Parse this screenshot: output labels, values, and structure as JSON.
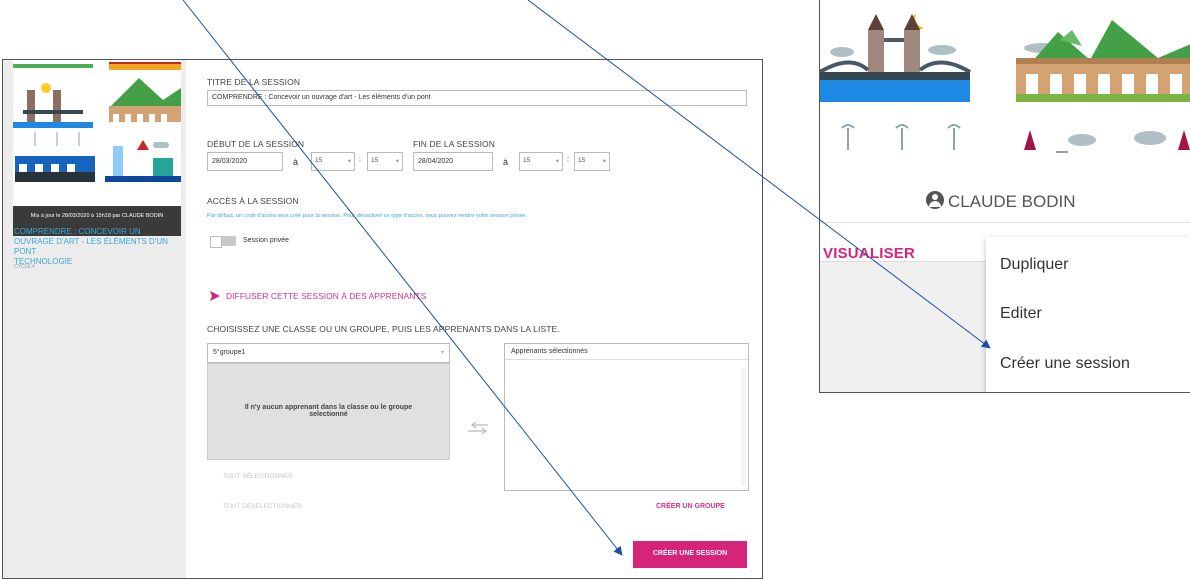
{
  "main": {
    "update_text": "Mis à jour le  28/03/2020 à 15h18  par CLAUDE BODIN",
    "course_title": "COMPRENDRE : CONCEVOIR UN OUVRAGE D'ART - LES ÉLÉMENTS D'UN PONT",
    "subject": "TECHNOLOGIE",
    "cycle": "CYCLE 4",
    "title_label": "TITRE DE LA SESSION",
    "title_value": "COMPRENDRE : Concevoir un ouvrage d'art - Les éléments d'un pont",
    "start_label": "DÉBUT DE LA SESSION",
    "start_date": "28/03/2020",
    "start_hour": "15",
    "start_min": "15",
    "end_label": "FIN DE LA SESSION",
    "end_date": "28/04/2020",
    "end_hour": "15",
    "end_min": "15",
    "at_label": "à",
    "colon": ":",
    "access_label": "ACCÈS À LA SESSION",
    "access_info": "Par défaut, un code d'accès sera créé pour la session. Pour désactiver ce type d'accès, vous pouvez rendre votre session privée.",
    "private_label": "Session privée",
    "diffuse_label": "DIFFUSER CETTE SESSION À DES APPRENANTS",
    "choose_label": "CHOISISSEZ UNE CLASSE OU UN GROUPE, PUIS LES APPRENANTS DANS LA LISTE.",
    "group_value": "5°groupe1",
    "no_learner": "Il n'y aucun apprenant dans la classe ou le groupe selectionné",
    "selected_learners": "Apprenants sélectionnés",
    "select_all": "TOUT SÉLECTIONNER",
    "deselect_all": "TOUT DÉSÉLECTIONNER",
    "create_group": "CRÉER UN GROUPE",
    "create_session_btn": "CRÉER UNE SESSION"
  },
  "card": {
    "author": "CLAUDE BODIN",
    "visualiser": "VISUALISER",
    "star_icon": "star-outline-icon",
    "menu": [
      "Dupliquer",
      "Editer",
      "Créer une session"
    ]
  },
  "colors": {
    "accent": "#d6247a",
    "link_blue": "#3aa8d6",
    "arrow_line": "#1f4e9e"
  }
}
